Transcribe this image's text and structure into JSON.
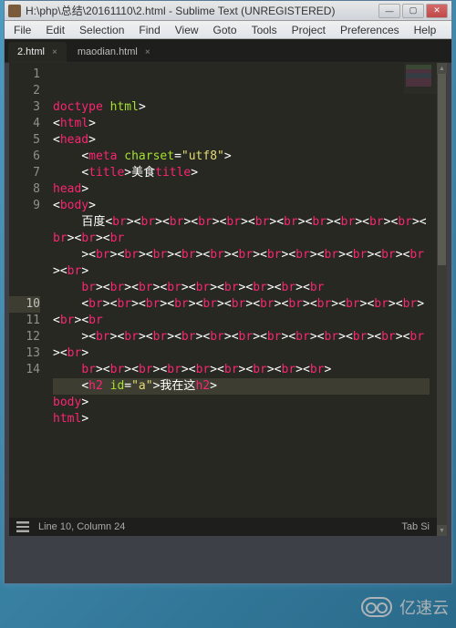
{
  "titlebar": {
    "title": "H:\\php\\总结\\20161110\\2.html - Sublime Text (UNREGISTERED)"
  },
  "menu": [
    "File",
    "Edit",
    "Selection",
    "Find",
    "View",
    "Goto",
    "Tools",
    "Project",
    "Preferences",
    "Help"
  ],
  "tabs": [
    {
      "label": "2.html",
      "active": true
    },
    {
      "label": "maodian.html",
      "active": false
    }
  ],
  "lines": [
    "1",
    "2",
    "3",
    "4",
    "5",
    "6",
    "7",
    "8",
    "9",
    "",
    "",
    "",
    "",
    "",
    "10",
    "11",
    "12",
    "13",
    "14"
  ],
  "highlight_index": 14,
  "code": {
    "l1": {
      "o": "<!",
      "t": "doctype",
      "s": " ",
      "a": "html",
      "c": ">"
    },
    "l2": {
      "o": "<",
      "t": "html",
      "c": ">"
    },
    "l3": {
      "o": "<",
      "t": "head",
      "c": ">"
    },
    "l4": {
      "o": "<",
      "t": "meta",
      "s": " ",
      "a": "charset",
      "eq": "=",
      "q": "\"",
      "v": "utf8",
      "q2": "\"",
      "c": ">"
    },
    "l5": {
      "o1": "<",
      "t1": "title",
      "c1": ">",
      "txt": "美食",
      "o2": "</",
      "t2": "title",
      "c2": ">"
    },
    "l7": {
      "o": "</",
      "t": "head",
      "c": ">"
    },
    "l8": {
      "o": "<",
      "t": "body",
      "c": ">"
    },
    "l9": {
      "txt": "百度"
    },
    "l10": {
      "o1": "<",
      "t1": "h2",
      "s": " ",
      "a": "id",
      "eq": "=",
      "q": "\"",
      "v": "a",
      "q2": "\"",
      "c1": ">",
      "txt": "我在这",
      "o2": "</",
      "t2": "h2",
      "c2": ">"
    },
    "l11": {
      "o": "</",
      "t": "body",
      "c": ">"
    },
    "l12": {
      "o": "</",
      "t": "html",
      "c": ">"
    }
  },
  "br_tag": {
    "o": "<",
    "t": "br",
    "c": ">"
  },
  "br_counts": [
    13,
    13,
    7,
    13,
    13,
    8
  ],
  "br_leading_close": [
    false,
    true,
    false,
    false,
    true,
    false
  ],
  "br_trailing_open": [
    true,
    false,
    true,
    true,
    false,
    false
  ],
  "status": {
    "pos": "Line 10, Column 24",
    "type": "Tab Si"
  },
  "watermark": "亿速云"
}
